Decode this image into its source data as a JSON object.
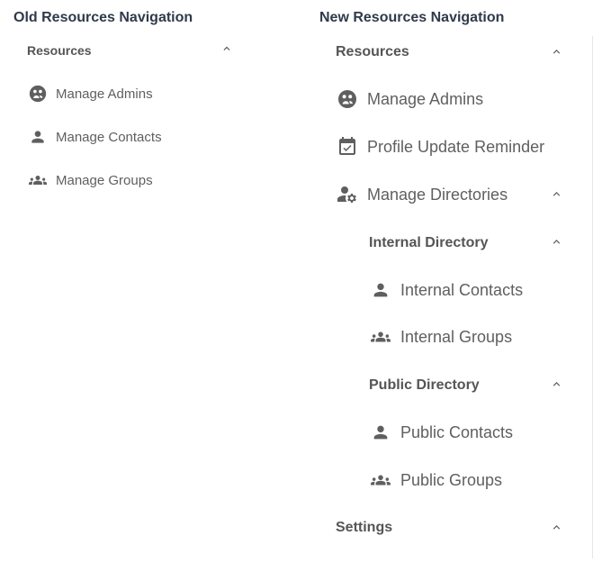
{
  "old_nav": {
    "title": "Old Resources Navigation",
    "section_label": "Resources",
    "items": [
      {
        "label": "Manage Admins",
        "icon": "admin-icon"
      },
      {
        "label": "Manage Contacts",
        "icon": "person-icon"
      },
      {
        "label": "Manage Groups",
        "icon": "groups-icon"
      }
    ]
  },
  "new_nav": {
    "title": "New Resources Navigation",
    "resources_label": "Resources",
    "items": [
      {
        "label": "Manage Admins",
        "icon": "admin-icon"
      },
      {
        "label": "Profile Update Reminder",
        "icon": "calendar-check-icon"
      },
      {
        "label": "Manage Directories",
        "icon": "person-settings-icon"
      }
    ],
    "internal_directory": {
      "label": "Internal Directory",
      "items": [
        {
          "label": "Internal Contacts",
          "icon": "person-icon"
        },
        {
          "label": "Internal Groups",
          "icon": "groups-icon"
        }
      ]
    },
    "public_directory": {
      "label": "Public Directory",
      "items": [
        {
          "label": "Public Contacts",
          "icon": "person-icon"
        },
        {
          "label": "Public Groups",
          "icon": "groups-icon"
        }
      ]
    },
    "settings_label": "Settings"
  },
  "colors": {
    "title": "#2f3a4a",
    "text": "#5f5f5f",
    "icon": "#5f5f5f"
  }
}
